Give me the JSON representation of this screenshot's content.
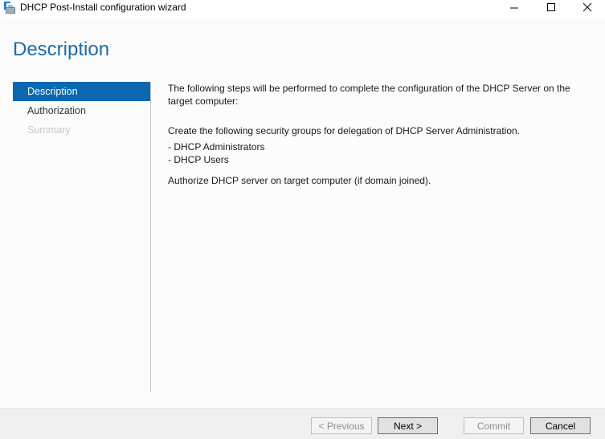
{
  "window": {
    "title": "DHCP Post-Install configuration wizard",
    "icon": "briefcase-server-icon",
    "controls": {
      "minimize": "minimize-icon",
      "maximize": "maximize-icon",
      "close": "close-icon"
    }
  },
  "page": {
    "heading": "Description"
  },
  "nav": {
    "items": [
      {
        "label": "Description",
        "state": "active"
      },
      {
        "label": "Authorization",
        "state": "enabled"
      },
      {
        "label": "Summary",
        "state": "disabled"
      }
    ]
  },
  "content": {
    "intro": "The following steps will be performed to complete the configuration of the DHCP Server on the target computer:",
    "groups_intro": "Create the following security groups for delegation of DHCP Server Administration.",
    "groups": [
      "- DHCP Administrators",
      "- DHCP Users"
    ],
    "authorize": "Authorize DHCP server on target computer (if domain joined)."
  },
  "footer": {
    "previous": "< Previous",
    "next": "Next >",
    "commit": "Commit",
    "cancel": "Cancel"
  },
  "colors": {
    "accent": "#0a67b2",
    "heading": "#1e6ba7"
  }
}
